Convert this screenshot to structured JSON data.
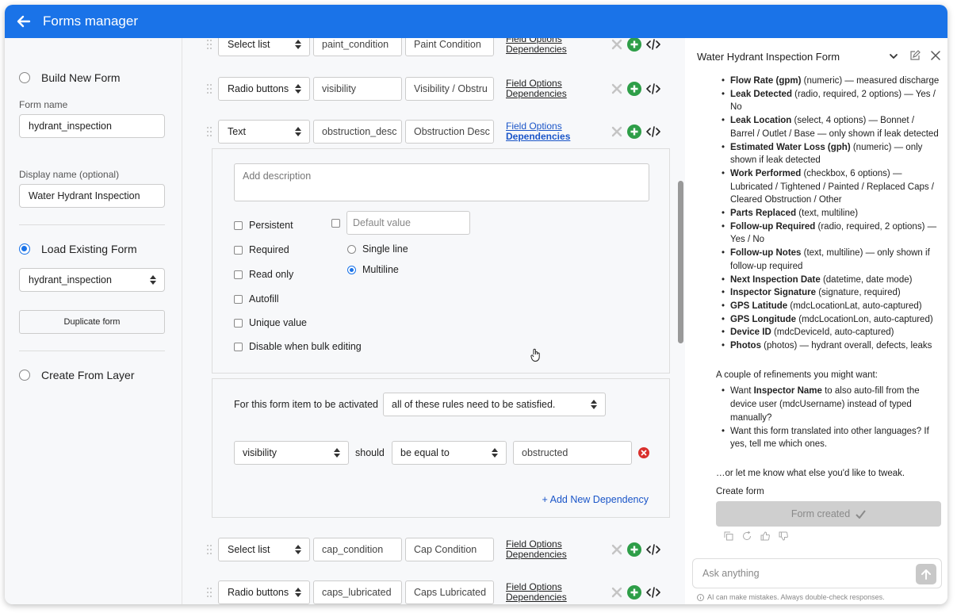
{
  "header": {
    "title": "Forms manager"
  },
  "left": {
    "build_new": "Build New Form",
    "form_name_label": "Form name",
    "form_name_value": "hydrant_inspection",
    "display_name_label": "Display name (optional)",
    "display_name_value": "Water Hydrant Inspection",
    "load_existing": "Load Existing Form",
    "existing_select": "hydrant_inspection",
    "duplicate_button": "Duplicate form",
    "create_from_layer": "Create From Layer"
  },
  "fields": [
    {
      "type": "Select list",
      "name": "paint_condition",
      "label": "Paint Condition"
    },
    {
      "type": "Radio buttons",
      "name": "visibility",
      "label": "Visibility / Obstru"
    },
    {
      "type": "Text",
      "name": "obstruction_desc",
      "label": "Obstruction Desc"
    },
    {
      "type": "Select list",
      "name": "cap_condition",
      "label": "Cap Condition"
    },
    {
      "type": "Radio buttons",
      "name": "caps_lubricated",
      "label": "Caps Lubricated"
    }
  ],
  "links": {
    "options": "Field Options",
    "deps": "Dependencies"
  },
  "editor": {
    "description_placeholder": "Add description",
    "default_placeholder": "Default value",
    "persistent": "Persistent",
    "required": "Required",
    "read_only": "Read only",
    "autofill": "Autofill",
    "unique": "Unique value",
    "disable_bulk": "Disable when bulk editing",
    "single_line": "Single line",
    "multiline": "Multiline"
  },
  "dependency": {
    "intro": "For this form item to be activated",
    "rule_mode": "all of these rules need to be satisfied.",
    "field": "visibility",
    "should": "should",
    "operator": "be equal to",
    "value": "obstructed",
    "add_new": "+ Add New Dependency"
  },
  "chat": {
    "title": "Water Hydrant Inspection Form",
    "items": [
      {
        "b": "Flow Rate (gpm)",
        "t": " (numeric) — measured discharge"
      },
      {
        "b": "Leak Detected",
        "t": " (radio, required, 2 options) — Yes / No"
      },
      {
        "b": "Leak Location",
        "t": " (select, 4 options) — Bonnet / Barrel / Outlet / Base — only shown if leak detected"
      },
      {
        "b": "Estimated Water Loss (gph)",
        "t": " (numeric) — only shown if leak detected"
      },
      {
        "b": "Work Performed",
        "t": " (checkbox, 6 options) — Lubricated / Tightened / Painted / Replaced Caps / Cleared Obstruction / Other"
      },
      {
        "b": "Parts Replaced",
        "t": " (text, multiline)"
      },
      {
        "b": "Follow-up Required",
        "t": " (radio, required, 2 options) — Yes / No"
      },
      {
        "b": "Follow-up Notes",
        "t": " (text, multiline) — only shown if follow-up required"
      },
      {
        "b": "Next Inspection Date",
        "t": " (datetime, date mode)"
      },
      {
        "b": "Inspector Signature",
        "t": " (signature, required)"
      },
      {
        "b": "GPS Latitude",
        "t": " (mdcLocationLat, auto-captured)"
      },
      {
        "b": "GPS Longitude",
        "t": " (mdcLocationLon, auto-captured)"
      },
      {
        "b": "Device ID",
        "t": " (mdcDeviceId, auto-captured)"
      },
      {
        "b": "Photos",
        "t": " (photos) — hydrant overall, defects, leaks"
      }
    ],
    "refine_intro": "A couple of refinements you might want:",
    "refine1_a": "Want ",
    "refine1_b": "Inspector Name",
    "refine1_c": " to also auto-fill from the device user (mdcUsername) instead of typed manually?",
    "refine2": "Want this form translated into other languages? If yes, tell me which ones.",
    "closing": "…or let me know what else you'd like to tweak.",
    "create_form": "Create form",
    "form_created": "Form created",
    "ask_placeholder": "Ask anything",
    "disclaimer": "AI can make mistakes. Always double-check responses."
  }
}
